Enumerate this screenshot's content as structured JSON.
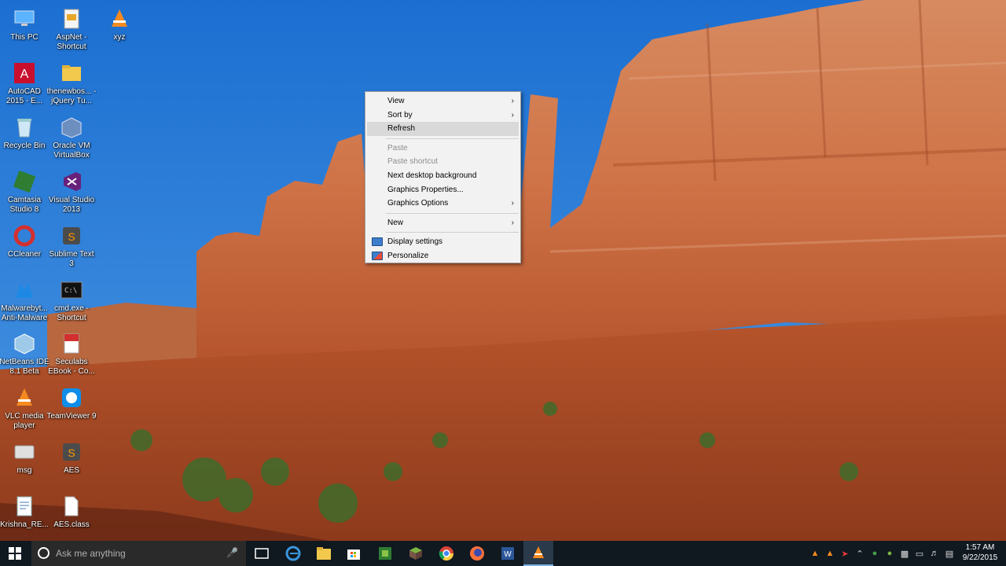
{
  "desktop": {
    "icons": [
      {
        "label": "This PC",
        "icon": "computer-icon"
      },
      {
        "label": "AspNet - Shortcut",
        "icon": "shortcut-icon"
      },
      {
        "label": "xyz",
        "icon": "vlc-cone-icon"
      },
      {
        "label": "AutoCAD 2015 - E...",
        "icon": "autocad-icon"
      },
      {
        "label": "thenewbos... - jQuery Tu...",
        "icon": "folder-icon"
      },
      {
        "label": "Recycle Bin",
        "icon": "recycle-bin-icon"
      },
      {
        "label": "Oracle VM VirtualBox",
        "icon": "virtualbox-icon"
      },
      {
        "label": "Camtasia Studio 8",
        "icon": "camtasia-icon"
      },
      {
        "label": "Visual Studio 2013",
        "icon": "visual-studio-icon"
      },
      {
        "label": "CCleaner",
        "icon": "ccleaner-icon"
      },
      {
        "label": "Sublime Text 3",
        "icon": "sublime-icon"
      },
      {
        "label": "Malwarebyt... Anti-Malware",
        "icon": "malwarebytes-icon"
      },
      {
        "label": "cmd.exe - Shortcut",
        "icon": "cmd-icon"
      },
      {
        "label": "NetBeans IDE 8.1 Beta",
        "icon": "netbeans-icon"
      },
      {
        "label": "Seculabs EBook - Co...",
        "icon": "pdf-icon"
      },
      {
        "label": "VLC media player",
        "icon": "vlc-cone-icon"
      },
      {
        "label": "TeamViewer 9",
        "icon": "teamviewer-icon"
      },
      {
        "label": "msg",
        "icon": "msg-icon"
      },
      {
        "label": "AES",
        "icon": "sublime-icon"
      },
      {
        "label": "Krishna_RE...",
        "icon": "document-icon"
      },
      {
        "label": "AES.class",
        "icon": "file-icon"
      }
    ]
  },
  "context_menu": {
    "items": [
      {
        "label": "View",
        "submenu": true,
        "disabled": false
      },
      {
        "label": "Sort by",
        "submenu": true,
        "disabled": false
      },
      {
        "label": "Refresh",
        "submenu": false,
        "disabled": false,
        "highlighted": true
      },
      {
        "label": "Paste",
        "submenu": false,
        "disabled": true
      },
      {
        "label": "Paste shortcut",
        "submenu": false,
        "disabled": true
      },
      {
        "label": "Next desktop background",
        "submenu": false,
        "disabled": false
      },
      {
        "label": "Graphics Properties...",
        "submenu": false,
        "disabled": false
      },
      {
        "label": "Graphics Options",
        "submenu": true,
        "disabled": false
      },
      {
        "label": "New",
        "submenu": true,
        "disabled": false
      },
      {
        "label": "Display settings",
        "submenu": false,
        "disabled": false,
        "icon": "display-icon"
      },
      {
        "label": "Personalize",
        "submenu": false,
        "disabled": false,
        "icon": "personalize-icon"
      }
    ],
    "arrow": "›"
  },
  "taskbar": {
    "search_placeholder": "Ask me anything",
    "pinned": [
      "task-view-icon",
      "edge-icon",
      "file-explorer-icon",
      "store-icon",
      "camtasia-icon",
      "minecraft-icon",
      "chrome-icon",
      "firefox-icon",
      "word-icon",
      "vlc-cone-icon"
    ],
    "clock_time": "1:57 AM",
    "clock_date": "9/22/2015"
  },
  "colors": {
    "sky": "#2f7fd6",
    "rock": "#c9653a",
    "taskbar": "#101820",
    "menu_bg": "#f2f2f2",
    "menu_highlight": "#d9d9d9"
  }
}
